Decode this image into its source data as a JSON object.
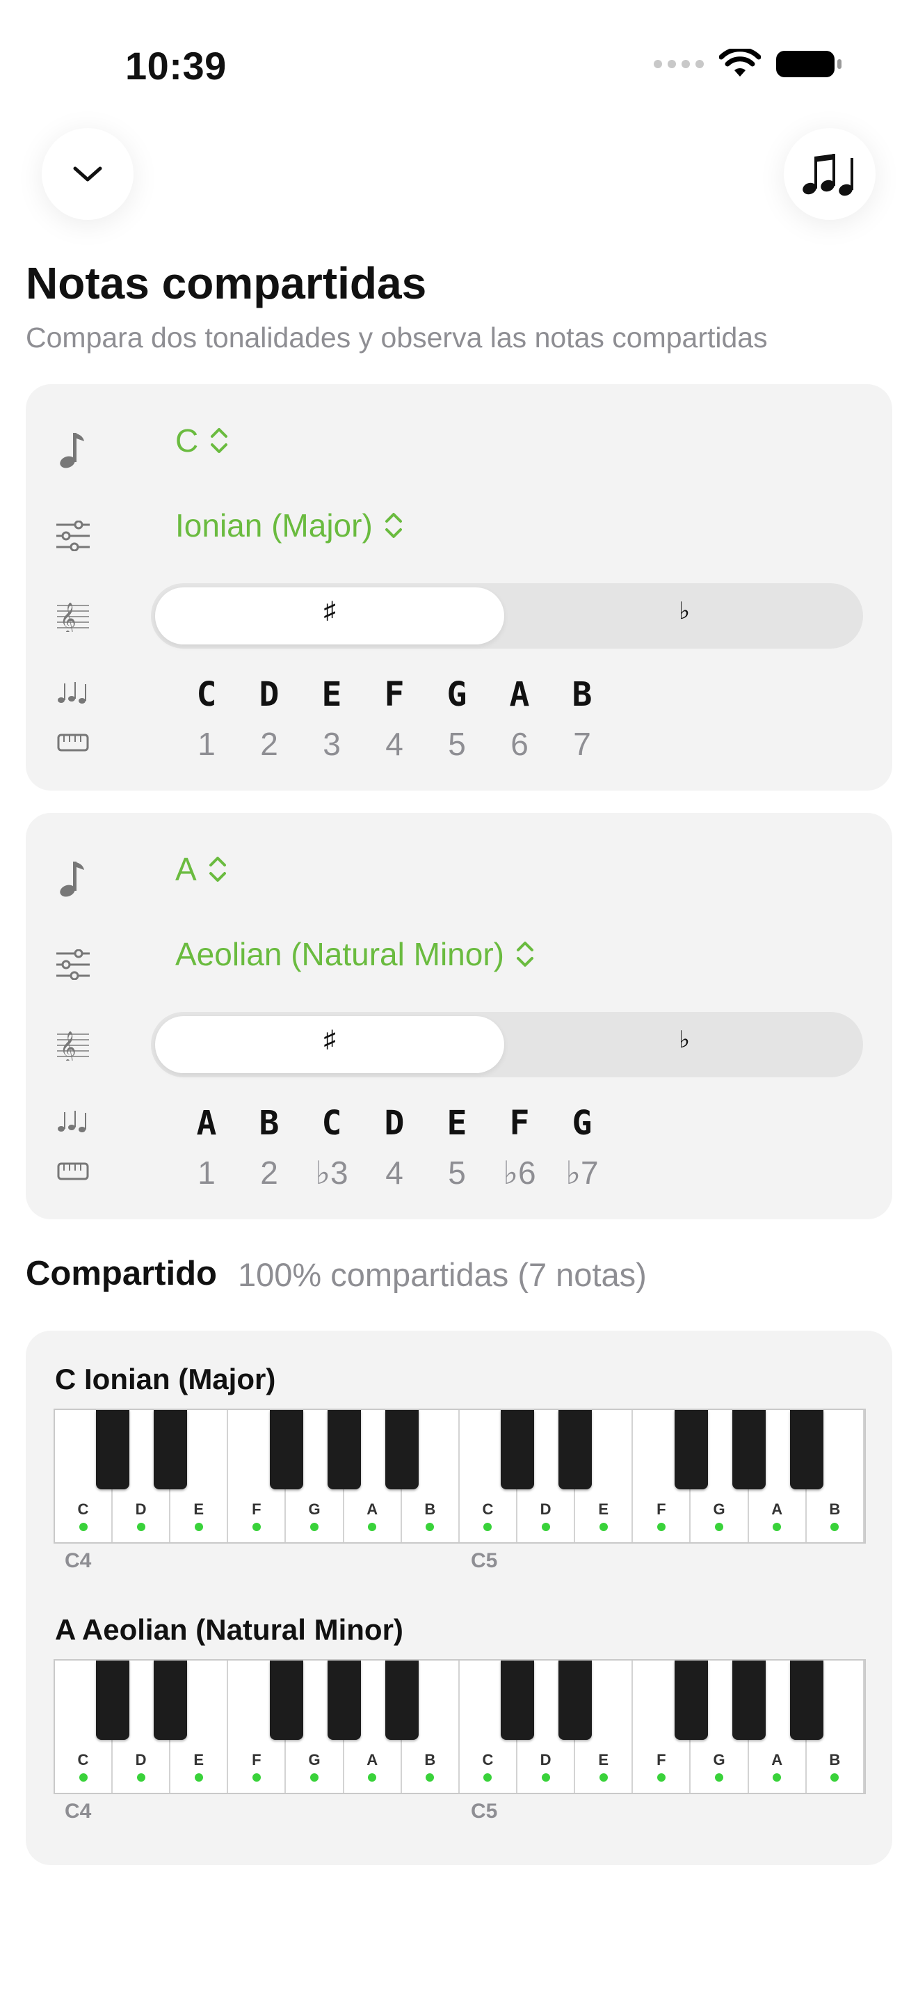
{
  "status": {
    "time": "10:39"
  },
  "header": {
    "title": "Notas compartidas",
    "subtitle": "Compara dos tonalidades y observa las notas compartidas"
  },
  "icons": {
    "collapse": "chevron-down-icon",
    "notes": "music-notes-icon",
    "note": "music-note-icon",
    "mode": "sliders-icon",
    "clef": "treble-clef-icon",
    "keyboard": "keyboard-icon"
  },
  "scale1": {
    "root": "C",
    "mode": "Ionian (Major)",
    "accidentals": {
      "sharp": "♯",
      "flat": "♭",
      "selected": "sharp"
    },
    "notes": [
      "C",
      "D",
      "E",
      "F",
      "G",
      "A",
      "B"
    ],
    "degrees": [
      "1",
      "2",
      "3",
      "4",
      "5",
      "6",
      "7"
    ]
  },
  "scale2": {
    "root": "A",
    "mode": "Aeolian (Natural Minor)",
    "accidentals": {
      "sharp": "♯",
      "flat": "♭",
      "selected": "sharp"
    },
    "notes": [
      "A",
      "B",
      "C",
      "D",
      "E",
      "F",
      "G"
    ],
    "degrees": [
      "1",
      "2",
      "♭3",
      "4",
      "5",
      "♭6",
      "♭7"
    ]
  },
  "shared": {
    "label": "Compartido",
    "summary": "100% compartidas (7 notas)"
  },
  "pianos": [
    {
      "title": "C Ionian (Major)",
      "keys": [
        "C",
        "D",
        "E",
        "F",
        "G",
        "A",
        "B",
        "C",
        "D",
        "E",
        "F",
        "G",
        "A",
        "B"
      ],
      "octave_labels": [
        "C4",
        "C5"
      ]
    },
    {
      "title": "A Aeolian (Natural Minor)",
      "keys": [
        "C",
        "D",
        "E",
        "F",
        "G",
        "A",
        "B",
        "C",
        "D",
        "E",
        "F",
        "G",
        "A",
        "B"
      ],
      "octave_labels": [
        "C4",
        "C5"
      ]
    }
  ],
  "colors": {
    "accent": "#6abb3f",
    "dot": "#39d23a",
    "card": "#f3f3f3"
  }
}
